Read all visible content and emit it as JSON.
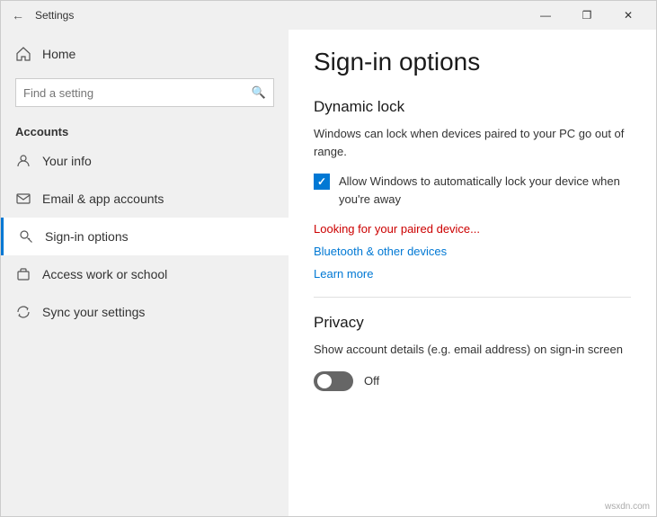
{
  "titlebar": {
    "title": "Settings",
    "back_label": "←",
    "minimize": "—",
    "restore": "❐",
    "close": "✕"
  },
  "sidebar": {
    "home_label": "Home",
    "search_placeholder": "Find a setting",
    "section_label": "Accounts",
    "items": [
      {
        "id": "your-info",
        "label": "Your info",
        "icon": "person"
      },
      {
        "id": "email-app-accounts",
        "label": "Email & app accounts",
        "icon": "email"
      },
      {
        "id": "sign-in-options",
        "label": "Sign-in options",
        "icon": "key",
        "active": true
      },
      {
        "id": "access-work-school",
        "label": "Access work or school",
        "icon": "briefcase"
      },
      {
        "id": "sync-settings",
        "label": "Sync your settings",
        "icon": "sync"
      }
    ]
  },
  "main": {
    "page_title": "Sign-in options",
    "dynamic_lock": {
      "section_title": "Dynamic lock",
      "description": "Windows can lock when devices paired to your PC go out of range.",
      "checkbox_label": "Allow Windows to automatically lock your device when you're away",
      "status_text": "Looking for your paired device...",
      "bluetooth_link": "Bluetooth & other devices",
      "learn_more": "Learn more"
    },
    "privacy": {
      "section_title": "Privacy",
      "description": "Show account details (e.g. email address) on sign-in screen",
      "toggle_label": "Off"
    }
  },
  "watermark": "wsxdn.com"
}
